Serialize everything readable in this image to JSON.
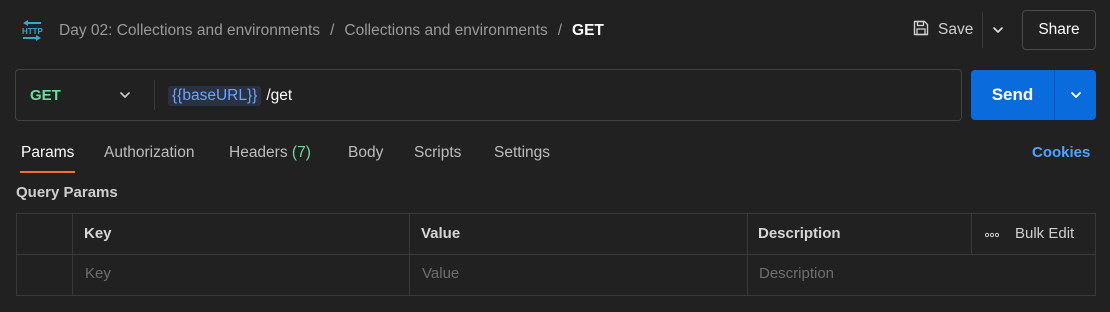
{
  "header": {
    "breadcrumbs": [
      "Day 02: Collections and environments",
      "Collections and environments"
    ],
    "current": "GET",
    "separator": "/",
    "icon": "http-request-icon",
    "save_label": "Save",
    "share_label": "Share"
  },
  "request": {
    "method": "GET",
    "url_variable": "{{baseURL}}",
    "url_path": "/get",
    "send_label": "Send"
  },
  "tabs": {
    "params": "Params",
    "authorization": "Authorization",
    "headers": "Headers",
    "headers_count": "(7)",
    "body": "Body",
    "scripts": "Scripts",
    "settings": "Settings",
    "cookies": "Cookies"
  },
  "query_params": {
    "title": "Query Params",
    "columns": {
      "key": "Key",
      "value": "Value",
      "description": "Description"
    },
    "bulk_edit": "Bulk Edit",
    "placeholders": {
      "key": "Key",
      "value": "Value",
      "description": "Description"
    }
  },
  "colors": {
    "background": "#212121",
    "method_get": "#6bdd9a",
    "send_button": "#0a6bdc",
    "active_tab_underline": "#ff6c37",
    "link": "#4da3ff",
    "variable": "#6fa3ff"
  }
}
